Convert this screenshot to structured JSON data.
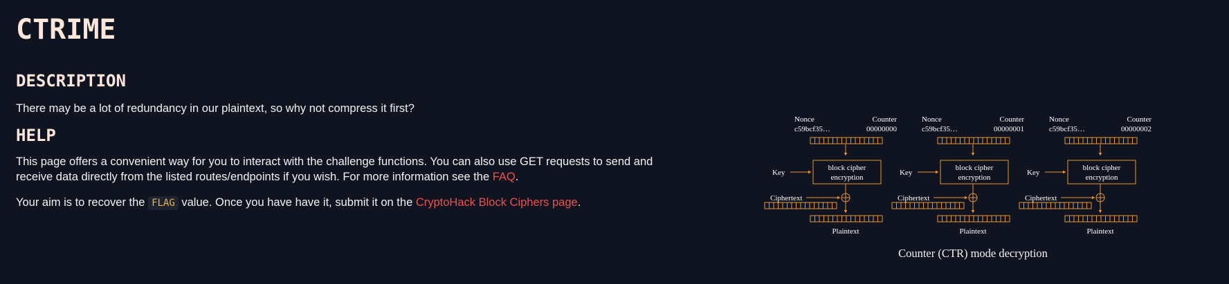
{
  "title": "CTRIME",
  "description": {
    "heading": "DESCRIPTION",
    "text": "There may be a lot of redundancy in our plaintext, so why not compress it first?"
  },
  "help": {
    "heading": "HELP",
    "line1": "This page offers a convenient way for you to interact with the challenge functions. You can also use GET requests to send and",
    "line2_pre": "receive data directly from the listed routes/endpoints if you wish. For more information see the ",
    "faq_link": "FAQ",
    "line2_post": ".",
    "aim_pre": "Your aim is to recover the ",
    "flag_code": "FLAG",
    "aim_mid": " value. Once you have have it, submit it on the ",
    "aim_link": "CryptoHack Block Ciphers page",
    "aim_post": "."
  },
  "diagram": {
    "caption": "Counter (CTR) mode decryption",
    "accent_color": "#e8963a",
    "blocks": [
      {
        "nonce_label": "Nonce",
        "counter_label": "Counter",
        "nonce_value": "c59bcf35…",
        "counter_value": "00000000",
        "key_label": "Key",
        "cipher_line1": "block cipher",
        "cipher_line2": "encryption",
        "ciphertext_label": "Ciphertext",
        "plaintext_label": "Plaintext"
      },
      {
        "nonce_label": "Nonce",
        "counter_label": "Counter",
        "nonce_value": "c59bcf35…",
        "counter_value": "00000001",
        "key_label": "Key",
        "cipher_line1": "block cipher",
        "cipher_line2": "encryption",
        "ciphertext_label": "Ciphertext",
        "plaintext_label": "Plaintext"
      },
      {
        "nonce_label": "Nonce",
        "counter_label": "Counter",
        "nonce_value": "c59bcf35…",
        "counter_value": "00000002",
        "key_label": "Key",
        "cipher_line1": "block cipher",
        "cipher_line2": "encryption",
        "ciphertext_label": "Ciphertext",
        "plaintext_label": "Plaintext"
      }
    ]
  }
}
